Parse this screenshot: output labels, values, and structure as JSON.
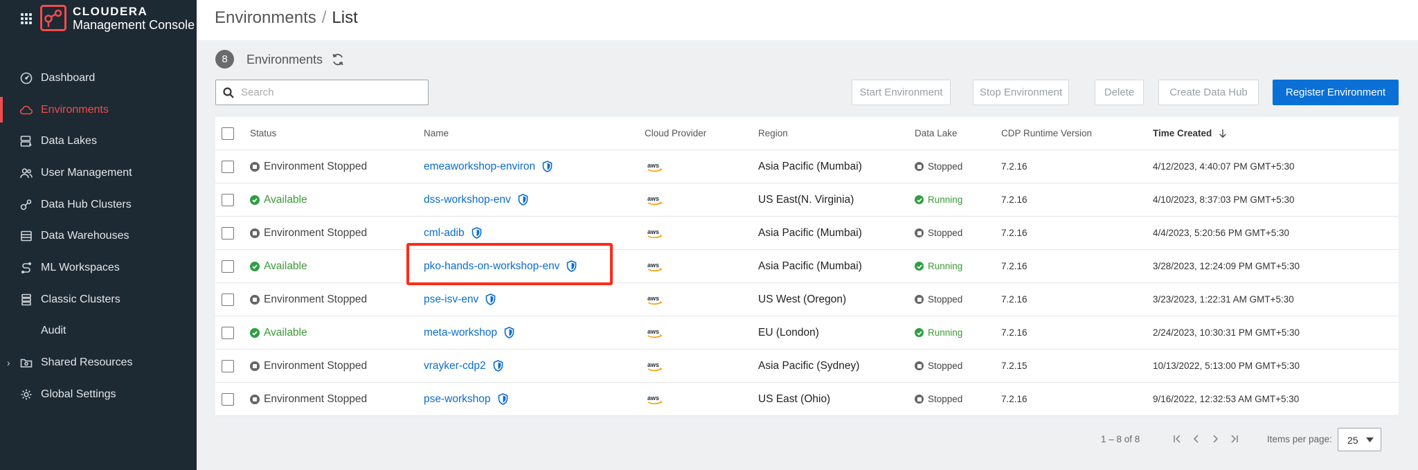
{
  "app": {
    "brand_line1": "CLOUDERA",
    "brand_line2": "Management Console"
  },
  "sidebar": {
    "items": [
      {
        "label": "Dashboard",
        "icon": "dashboard-icon"
      },
      {
        "label": "Environments",
        "icon": "cloud-icon",
        "active": true
      },
      {
        "label": "Data Lakes",
        "icon": "data-lakes-icon"
      },
      {
        "label": "User Management",
        "icon": "users-icon"
      },
      {
        "label": "Data Hub Clusters",
        "icon": "data-hub-icon"
      },
      {
        "label": "Data Warehouses",
        "icon": "warehouse-icon"
      },
      {
        "label": "ML Workspaces",
        "icon": "ml-icon"
      },
      {
        "label": "Classic Clusters",
        "icon": "cluster-icon"
      },
      {
        "label": "Audit",
        "icon": "audit-icon"
      },
      {
        "label": "Shared Resources",
        "icon": "folder-icon",
        "expandable": true
      },
      {
        "label": "Global Settings",
        "icon": "gear-icon"
      }
    ]
  },
  "header": {
    "breadcrumb_root": "Environments",
    "breadcrumb_sep": "/",
    "breadcrumb_current": "List"
  },
  "toolbar": {
    "count": "8",
    "title": "Environments",
    "search_placeholder": "Search",
    "start": "Start Environment",
    "stop": "Stop Environment",
    "delete": "Delete",
    "create_hub": "Create Data Hub",
    "register": "Register Environment"
  },
  "table": {
    "columns": {
      "status": "Status",
      "name": "Name",
      "cloud": "Cloud Provider",
      "region": "Region",
      "datalake": "Data Lake",
      "runtime": "CDP Runtime Version",
      "time": "Time Created"
    },
    "rows": [
      {
        "status": "Environment Stopped",
        "status_kind": "stopped",
        "name": "emeaworkshop-environ",
        "cloud": "aws",
        "region": "Asia Pacific (Mumbai)",
        "datalake": "Stopped",
        "dl_kind": "stopped",
        "runtime": "7.2.16",
        "time": "4/12/2023, 4:40:07 PM GMT+5:30"
      },
      {
        "status": "Available",
        "status_kind": "ok",
        "name": "dss-workshop-env",
        "cloud": "aws",
        "region": "US East(N. Virginia)",
        "datalake": "Running",
        "dl_kind": "ok",
        "runtime": "7.2.16",
        "time": "4/10/2023, 8:37:03 PM GMT+5:30"
      },
      {
        "status": "Environment Stopped",
        "status_kind": "stopped",
        "name": "cml-adib",
        "cloud": "aws",
        "region": "Asia Pacific (Mumbai)",
        "datalake": "Stopped",
        "dl_kind": "stopped",
        "runtime": "7.2.16",
        "time": "4/4/2023, 5:20:56 PM GMT+5:30"
      },
      {
        "status": "Available",
        "status_kind": "ok",
        "name": "pko-hands-on-workshop-env",
        "cloud": "aws",
        "region": "Asia Pacific (Mumbai)",
        "datalake": "Running",
        "dl_kind": "ok",
        "runtime": "7.2.16",
        "time": "3/28/2023, 12:24:09 PM GMT+5:30"
      },
      {
        "status": "Environment Stopped",
        "status_kind": "stopped",
        "name": "pse-isv-env",
        "cloud": "aws",
        "region": "US West (Oregon)",
        "datalake": "Stopped",
        "dl_kind": "stopped",
        "runtime": "7.2.16",
        "time": "3/23/2023, 1:22:31 AM GMT+5:30"
      },
      {
        "status": "Available",
        "status_kind": "ok",
        "name": "meta-workshop",
        "cloud": "aws",
        "region": "EU (London)",
        "datalake": "Running",
        "dl_kind": "ok",
        "runtime": "7.2.16",
        "time": "2/24/2023, 10:30:31 PM GMT+5:30"
      },
      {
        "status": "Environment Stopped",
        "status_kind": "stopped",
        "name": "vrayker-cdp2",
        "cloud": "aws",
        "region": "Asia Pacific (Sydney)",
        "datalake": "Stopped",
        "dl_kind": "stopped",
        "runtime": "7.2.15",
        "time": "10/13/2022, 5:13:00 PM GMT+5:30"
      },
      {
        "status": "Environment Stopped",
        "status_kind": "stopped",
        "name": "pse-workshop",
        "cloud": "aws",
        "region": "US East (Ohio)",
        "datalake": "Stopped",
        "dl_kind": "stopped",
        "runtime": "7.2.16",
        "time": "9/16/2022, 12:32:53 AM GMT+5:30"
      }
    ]
  },
  "pagination": {
    "range": "1 – 8 of 8",
    "items_per_page_label": "Items per page:",
    "items_per_page": "25"
  },
  "colors": {
    "accent": "#0a70d6",
    "active_nav": "#f24c4c",
    "running": "#2f9e44",
    "highlight": "#ff2a1a"
  }
}
